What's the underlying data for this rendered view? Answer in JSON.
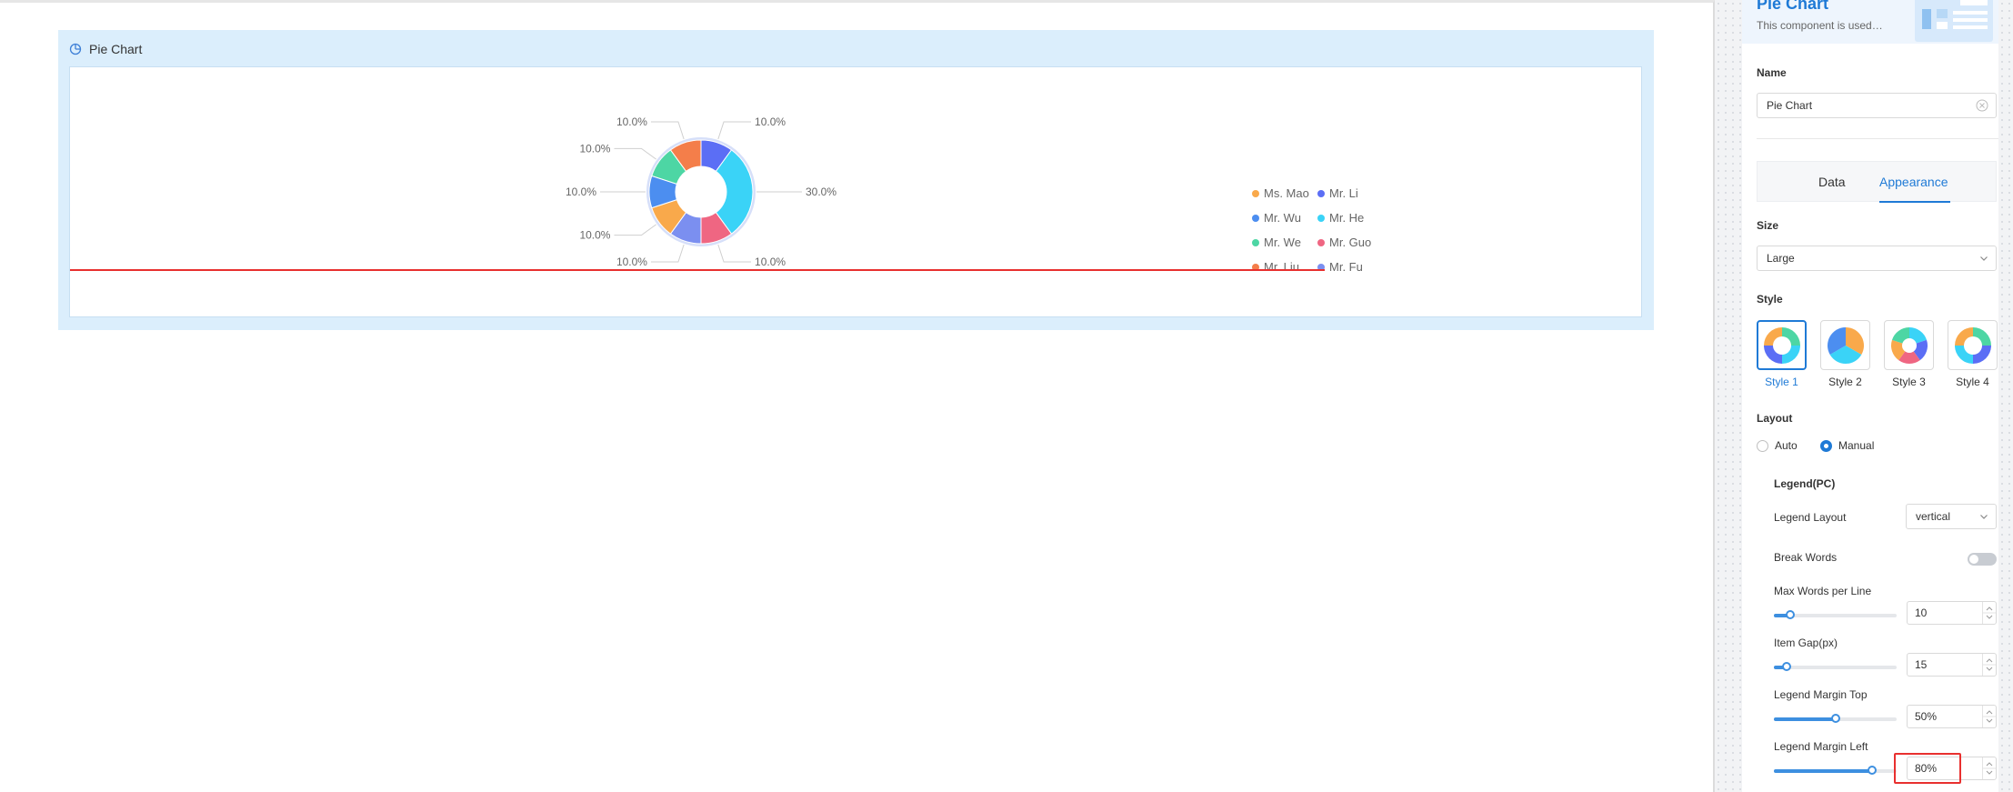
{
  "widget": {
    "title": "Pie Chart",
    "icon": "pie-chart-icon"
  },
  "chart_data": {
    "type": "pie",
    "style": "donut",
    "categories": [
      "Mr. Li",
      "Mr. He",
      "Mr. Guo",
      "Mr. Fu",
      "Ms. Mao",
      "Mr. Wu",
      "Mr. We",
      "Mr. Liu"
    ],
    "values": [
      10,
      30,
      10,
      10,
      10,
      10,
      10,
      10
    ],
    "labels": [
      "10.0%",
      "30.0%",
      "10.0%",
      "10.0%",
      "10.0%",
      "10.0%",
      "10.0%",
      "10.0%"
    ],
    "colors": [
      "#5b6ef5",
      "#3ad3f7",
      "#ef6682",
      "#7b8ff0",
      "#f9a94b",
      "#4c8ef0",
      "#4dd6a4",
      "#f47e4a"
    ],
    "legend": {
      "placement": "right",
      "entries": [
        {
          "name": "Ms. Mao",
          "color": "#f9a94b"
        },
        {
          "name": "Mr. Li",
          "color": "#5b6ef5"
        },
        {
          "name": "Mr. Wu",
          "color": "#4c8ef0"
        },
        {
          "name": "Mr. He",
          "color": "#3ad3f7"
        },
        {
          "name": "Mr. We",
          "color": "#4dd6a4"
        },
        {
          "name": "Mr. Guo",
          "color": "#ef6682"
        },
        {
          "name": "Mr. Liu",
          "color": "#f47e4a"
        },
        {
          "name": "Mr. Fu",
          "color": "#7b8ff0"
        }
      ]
    }
  },
  "panel": {
    "title": "Pie Chart",
    "description": "This component is used to draw a pie chart",
    "name_label": "Name",
    "name_value": "Pie Chart",
    "tabs": [
      {
        "label": "Data",
        "active": false
      },
      {
        "label": "Appearance",
        "active": true
      }
    ],
    "size_label": "Size",
    "size_value": "Large",
    "style_label": "Style",
    "styles": [
      {
        "label": "Style 1",
        "active": true
      },
      {
        "label": "Style 2",
        "active": false
      },
      {
        "label": "Style 3",
        "active": false
      },
      {
        "label": "Style 4",
        "active": false
      }
    ],
    "layout_label": "Layout",
    "layout_options": [
      {
        "label": "Auto",
        "checked": false
      },
      {
        "label": "Manual",
        "checked": true
      }
    ],
    "legend_section_title": "Legend(PC)",
    "legend_layout_label": "Legend Layout",
    "legend_layout_value": "vertical",
    "break_words_label": "Break Words",
    "break_words_on": false,
    "sliders": [
      {
        "label": "Max Words per Line",
        "value": "10",
        "level": 0.13
      },
      {
        "label": "Item Gap(px)",
        "value": "15",
        "level": 0.1
      },
      {
        "label": "Legend Margin Top",
        "value": "50%",
        "level": 0.5
      },
      {
        "label": "Legend Margin Left",
        "value": "80%",
        "level": 0.8
      }
    ],
    "accent_color": "#1f7ad6",
    "highlight_color": "#e8302f"
  }
}
